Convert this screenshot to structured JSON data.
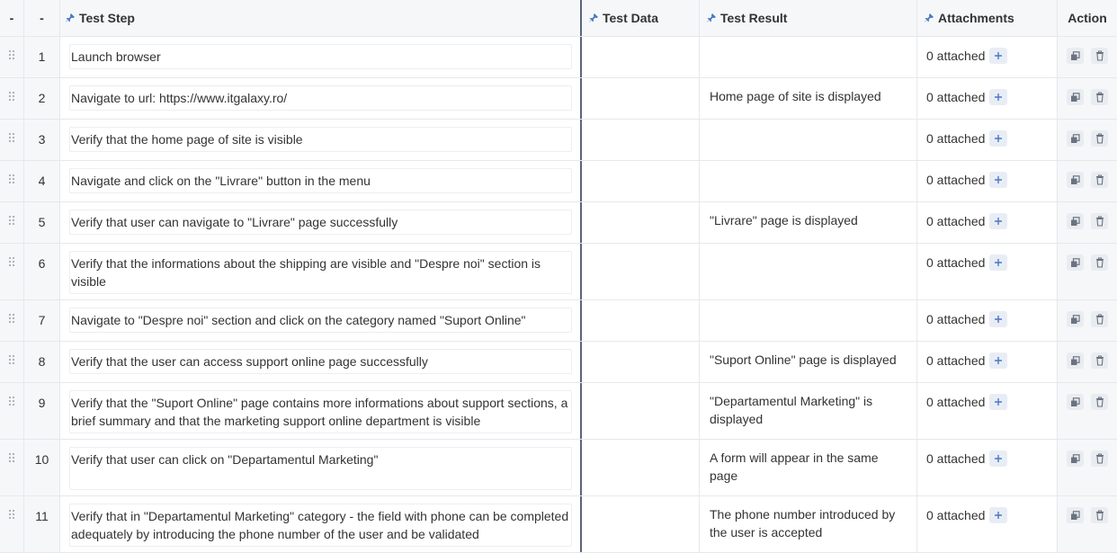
{
  "header": {
    "drag": "-",
    "num": "-",
    "step": "Test Step",
    "data": "Test Data",
    "result": "Test Result",
    "attachments": "Attachments",
    "action": "Action"
  },
  "rows": [
    {
      "num": "1",
      "step": "Launch browser",
      "data": "",
      "result": "",
      "attachments": "0 attached"
    },
    {
      "num": "2",
      "step": "Navigate to url: https://www.itgalaxy.ro/",
      "data": "",
      "result": "Home page of site is displayed",
      "attachments": "0 attached"
    },
    {
      "num": "3",
      "step": "Verify that the home page of site is visible",
      "data": "",
      "result": "",
      "attachments": "0 attached"
    },
    {
      "num": "4",
      "step": "Navigate and click on the \"Livrare\" button in the menu",
      "data": "",
      "result": "",
      "attachments": "0 attached"
    },
    {
      "num": "5",
      "step": "Verify that user can navigate to \"Livrare\" page successfully",
      "data": "",
      "result": "\"Livrare\" page is displayed",
      "attachments": "0 attached"
    },
    {
      "num": "6",
      "step": "Verify that the informations about the shipping are visible and \"Despre noi\" section is visible",
      "data": "",
      "result": "",
      "attachments": "0 attached"
    },
    {
      "num": "7",
      "step": "Navigate to \"Despre noi\" section and click on the category named \"Suport Online\"",
      "data": "",
      "result": "",
      "attachments": "0 attached"
    },
    {
      "num": "8",
      "step": "Verify that the user can access support online page successfully",
      "data": "",
      "result": "\"Suport Online\" page is displayed",
      "attachments": "0 attached"
    },
    {
      "num": "9",
      "step": "Verify that the \"Suport Online\" page contains more informations about support sections, a brief summary and that the marketing support online department is visible",
      "data": "",
      "result": "\"Departamentul Marketing\" is displayed",
      "attachments": "0 attached"
    },
    {
      "num": "10",
      "step": "Verify that user can click on \"Departamentul Marketing\"",
      "data": "",
      "result": "A form will appear in the same page",
      "attachments": "0 attached"
    },
    {
      "num": "11",
      "step": "Verify that in \"Departamentul Marketing\" category - the field with phone can be completed adequately by introducing the phone number of the user and be validated",
      "data": "",
      "result": "The phone number introduced by the user is accepted",
      "attachments": "0 attached"
    }
  ]
}
